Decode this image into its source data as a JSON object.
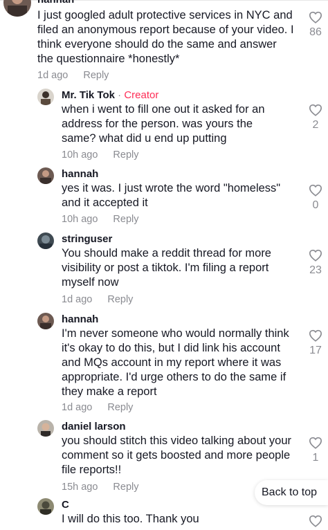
{
  "comments": [
    {
      "author": "hannah",
      "text": "I just googled adult protective services in NYC and filed an anonymous report because of your video. I think everyone should do the same and answer the questionnaire *honestly*",
      "time": "1d ago",
      "reply": "Reply",
      "likes": "86"
    },
    {
      "author": "Mr. Tik Tok",
      "separator": " · ",
      "creator_badge": "Creator",
      "text": "when i went to fill one out it asked for an address for the person. was yours the same? what did u end up putting",
      "time": "10h ago",
      "reply": "Reply",
      "likes": "2"
    },
    {
      "author": "hannah",
      "text": "yes it was. I just wrote the word \"homeless\" and it accepted it",
      "time": "10h ago",
      "reply": "Reply",
      "likes": "0"
    },
    {
      "author": "stringuser",
      "text": "You should make a reddit thread for more visibility or post a tiktok. I'm filing a report myself now",
      "time": "1d ago",
      "reply": "Reply",
      "likes": "23"
    },
    {
      "author": "hannah",
      "text": "I'm never someone who would normally think it's okay to do this, but I did link his account and MQs account in my report where it was appropriate. I'd urge others to do the same if they make a report",
      "time": "1d ago",
      "reply": "Reply",
      "likes": "17"
    },
    {
      "author": "daniel larson",
      "text": "you should stitch this video talking about your comment so it gets boosted and more people file reports!!",
      "time": "15h ago",
      "reply": "Reply",
      "likes": "1"
    },
    {
      "author": "C",
      "text": "I will do this too. Thank you",
      "time": "",
      "reply": "",
      "likes": ""
    }
  ],
  "back_to_top": "Back to top",
  "icons": {
    "like": "heart-outline-icon"
  },
  "colors": {
    "creator": "#fe2c55",
    "muted": "#8a8b91",
    "text": "#161823"
  }
}
